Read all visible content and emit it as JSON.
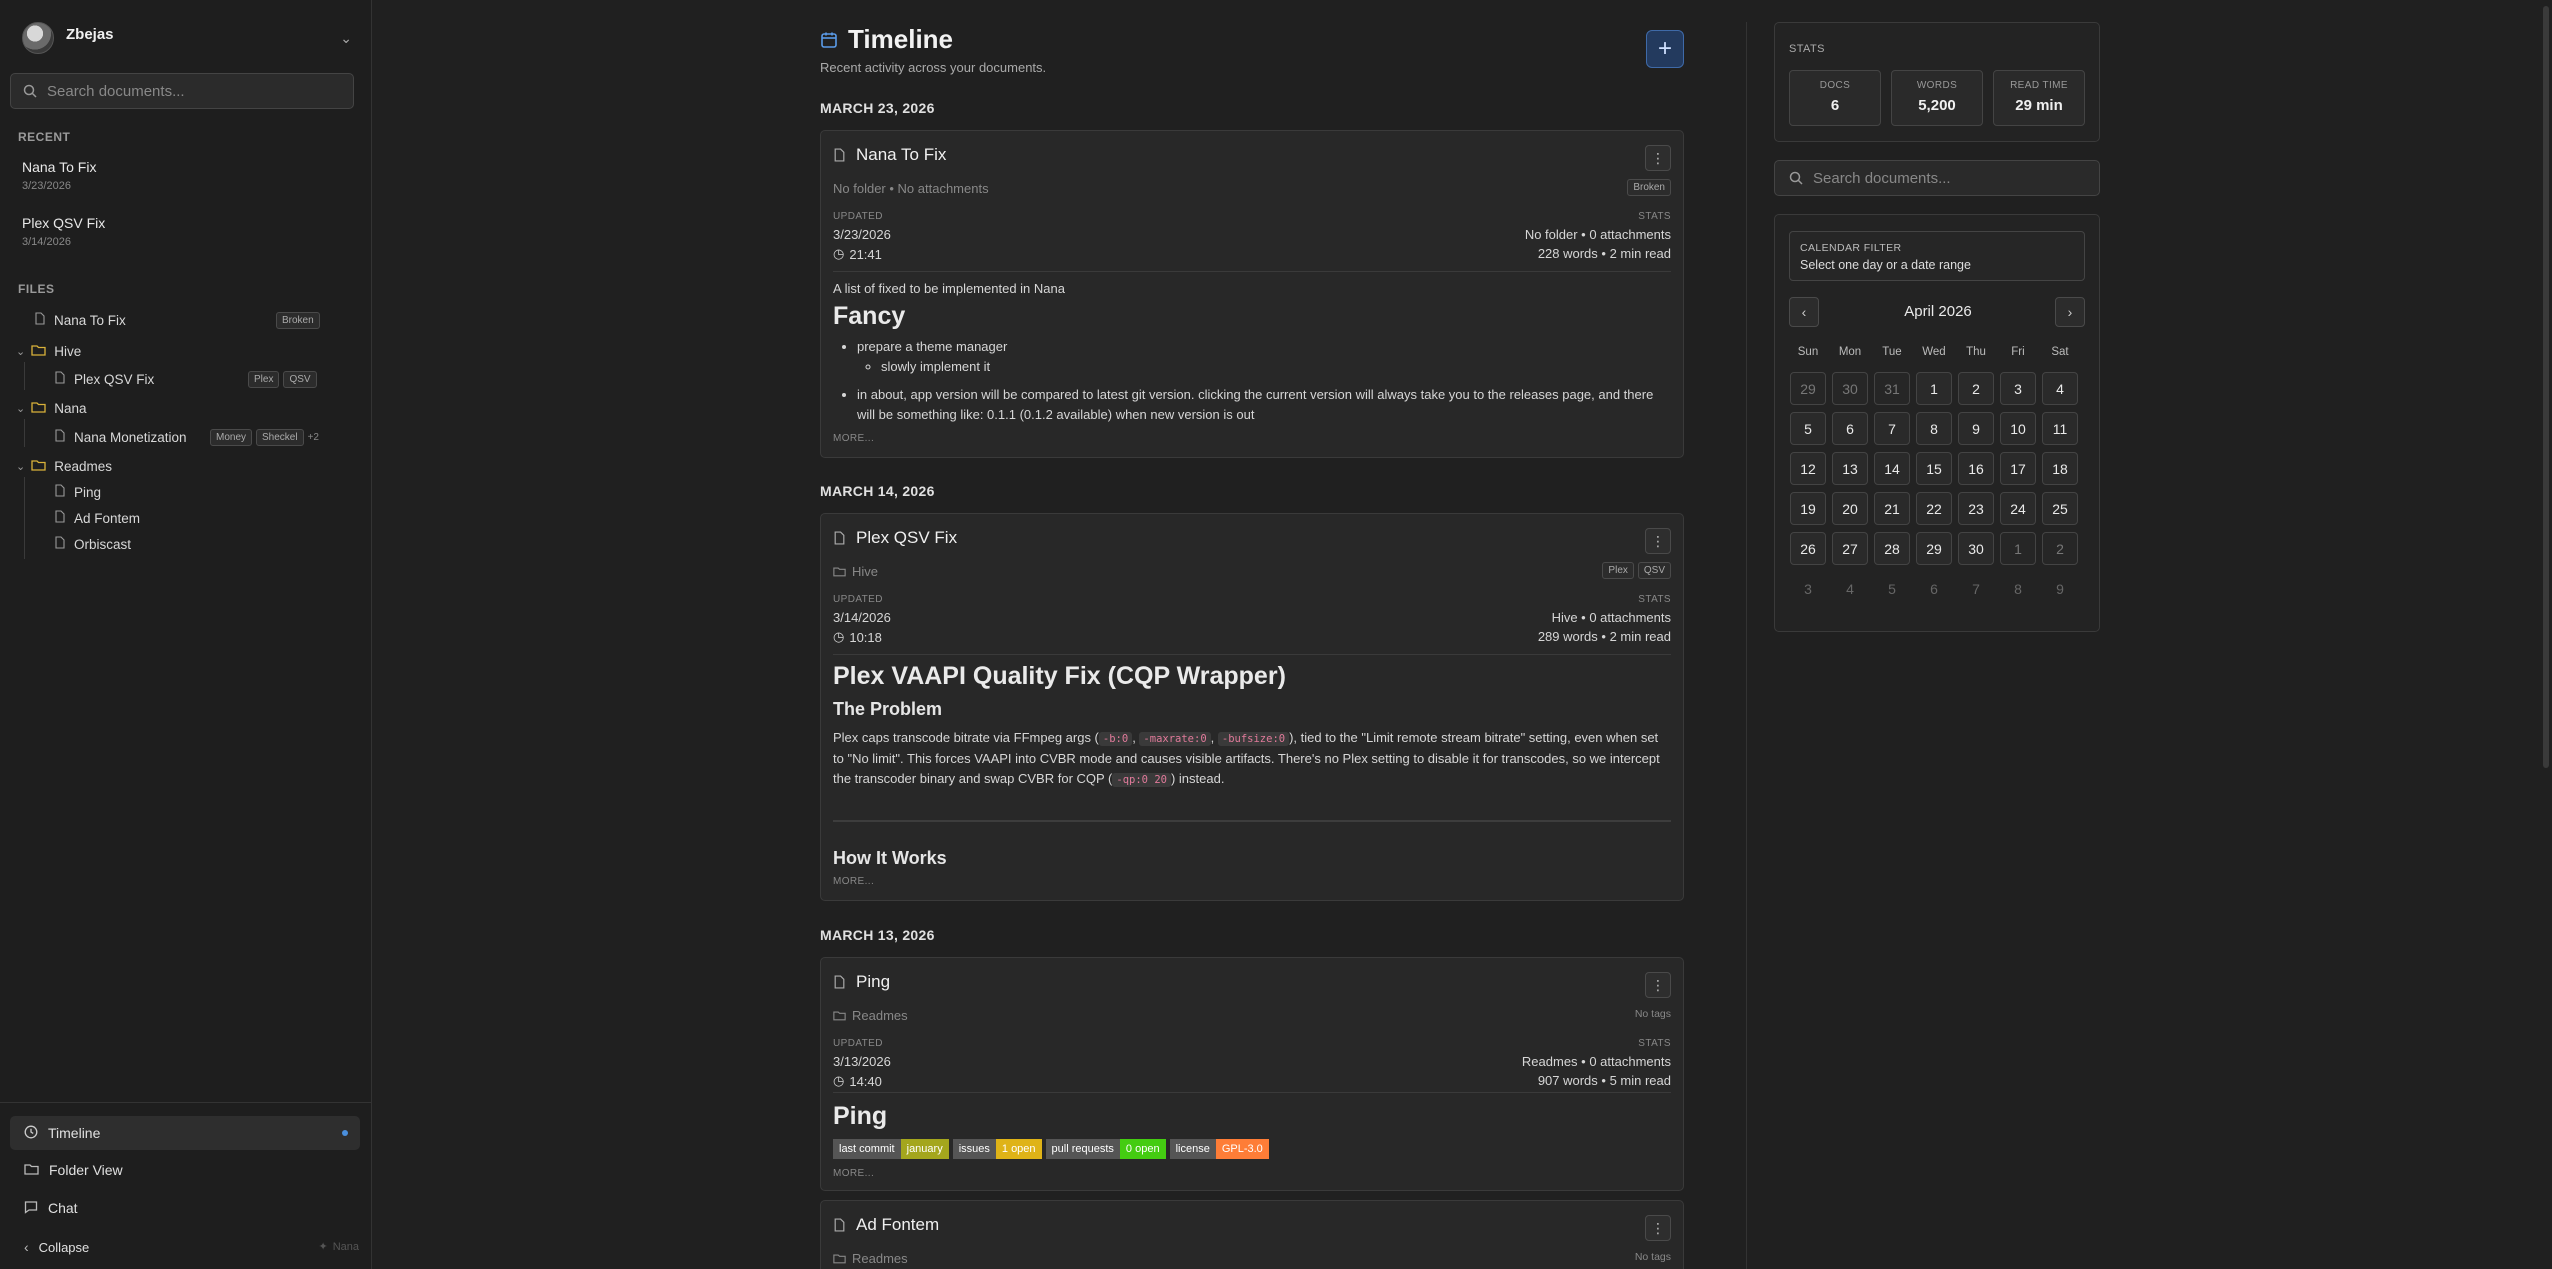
{
  "sidebar": {
    "user": {
      "name": "Zbejas"
    },
    "search_placeholder": "Search documents...",
    "recent_label": "RECENT",
    "recent": [
      {
        "title": "Nana To Fix",
        "date": "3/23/2026"
      },
      {
        "title": "Plex QSV Fix",
        "date": "3/14/2026"
      }
    ],
    "files_label": "FILES",
    "files": {
      "nana_to_fix": {
        "name": "Nana To Fix",
        "tags": [
          "Broken"
        ]
      },
      "hive": {
        "name": "Hive"
      },
      "plex_qsv_fix": {
        "name": "Plex QSV Fix",
        "tags": [
          "Plex",
          "QSV"
        ]
      },
      "nana": {
        "name": "Nana"
      },
      "nana_monetization": {
        "name": "Nana Monetization",
        "tags": [
          "Money",
          "Sheckel"
        ],
        "more": "+2"
      },
      "readmes": {
        "name": "Readmes"
      },
      "ping": {
        "name": "Ping"
      },
      "ad_fontem": {
        "name": "Ad Fontem"
      },
      "orbiscast": {
        "name": "Orbiscast"
      }
    },
    "nav": {
      "timeline": "Timeline",
      "folder_view": "Folder View",
      "chat": "Chat",
      "collapse": "Collapse"
    },
    "brand": "Nana"
  },
  "main": {
    "title": "Timeline",
    "subtitle": "Recent activity across your documents.",
    "add_label": "+",
    "groups": {
      "g1": "MARCH 23, 2026",
      "g2": "MARCH 14, 2026",
      "g3": "MARCH 13, 2026"
    },
    "cards": {
      "nana": {
        "title": "Nana To Fix",
        "sub": "No folder • No attachments",
        "tags": [
          "Broken"
        ],
        "updated_label": "UPDATED",
        "date": "3/23/2026",
        "time": "21:41",
        "stats_label": "STATS",
        "stats_line1": "No folder  •  0 attachments",
        "stats_line2": "228 words  •  2 min read",
        "intro": "A list of fixed to be implemented in Nana",
        "heading": "Fancy",
        "item1": "prepare a theme manager",
        "item1a": "slowly implement it",
        "item2": "in about, app version will be compared to latest git version. clicking the current version will always take you to the releases page, and there will be something like: 0.1.1 (0.1.2 available) when new version is out",
        "more": "MORE..."
      },
      "plex": {
        "title": "Plex QSV Fix",
        "folder": "Hive",
        "tags": [
          "Plex",
          "QSV"
        ],
        "updated_label": "UPDATED",
        "date": "3/14/2026",
        "time": "10:18",
        "stats_label": "STATS",
        "stats_line1": "Hive  •  0 attachments",
        "stats_line2": "289 words  •  2 min read",
        "heading": "Plex VAAPI Quality Fix (CQP Wrapper)",
        "subheading": "The Problem",
        "p_a": "Plex caps transcode bitrate via FFmpeg args (",
        "code1": "-b:0",
        "sep1": ", ",
        "code2": "-maxrate:0",
        "sep2": ", ",
        "code3": "-bufsize:0",
        "p_b": "), tied to the \"Limit remote stream bitrate\" setting, even when set to \"No limit\". This forces VAAPI into CVBR mode and causes visible artifacts. There's no Plex setting to disable it for transcodes, so we intercept the transcoder binary and swap CVBR for CQP (",
        "code4": "-qp:0 20",
        "p_c": ") instead.",
        "heading2": "How It Works",
        "more": "MORE..."
      },
      "ping": {
        "title": "Ping",
        "folder": "Readmes",
        "no_tags": "No tags",
        "updated_label": "UPDATED",
        "date": "3/13/2026",
        "time": "14:40",
        "stats_label": "STATS",
        "stats_line1": "Readmes  •  0 attachments",
        "stats_line2": "907 words  •  5 min read",
        "heading": "Ping",
        "badges": {
          "b1": {
            "k": "last commit",
            "v": "january",
            "color": "#a4a61d"
          },
          "b2": {
            "k": "issues",
            "v": "1 open",
            "color": "#dfb317"
          },
          "b3": {
            "k": "pull requests",
            "v": "0 open",
            "color": "#44cc11"
          },
          "b4": {
            "k": "license",
            "v": "GPL-3.0",
            "color": "#fe7d37"
          }
        },
        "more": "MORE..."
      },
      "adfontem": {
        "title": "Ad Fontem",
        "folder": "Readmes",
        "no_tags": "No tags"
      }
    }
  },
  "right": {
    "stats_label": "STATS",
    "docs_label": "DOCS",
    "docs": "6",
    "words_label": "WORDS",
    "words": "5,200",
    "read_label": "READ TIME",
    "read": "29 min",
    "search_placeholder": "Search documents...",
    "calendar": {
      "filter_label": "CALENDAR FILTER",
      "filter_hint": "Select one day or a date range",
      "month": "April 2026",
      "weekdays": [
        "Sun",
        "Mon",
        "Tue",
        "Wed",
        "Thu",
        "Fri",
        "Sat"
      ],
      "rows": [
        [
          "29",
          "30",
          "31",
          "1",
          "2",
          "3",
          "4"
        ],
        [
          "5",
          "6",
          "7",
          "8",
          "9",
          "10",
          "11"
        ],
        [
          "12",
          "13",
          "14",
          "15",
          "16",
          "17",
          "18"
        ],
        [
          "19",
          "20",
          "21",
          "22",
          "23",
          "24",
          "25"
        ],
        [
          "26",
          "27",
          "28",
          "29",
          "30",
          "1",
          "2"
        ],
        [
          "3",
          "4",
          "5",
          "6",
          "7",
          "8",
          "9"
        ]
      ]
    }
  }
}
